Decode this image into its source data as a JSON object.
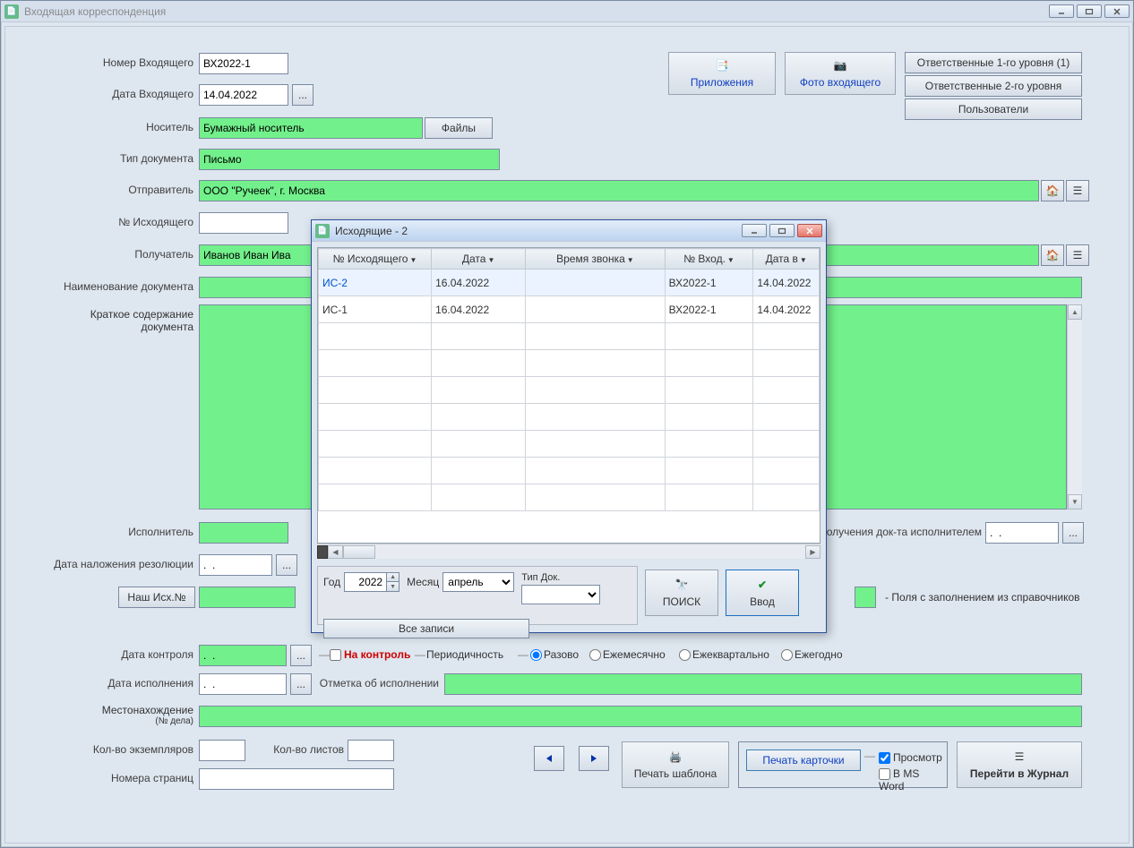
{
  "main": {
    "title": "Входящая корреспонденция",
    "labels": {
      "incoming_no": "Номер Входящего",
      "incoming_date": "Дата Входящего",
      "medium": "Носитель",
      "doc_type": "Тип документа",
      "sender": "Отправитель",
      "outgoing_no": "№ Исходящего",
      "recipient": "Получатель",
      "doc_name": "Наименование документа",
      "summary1": "Краткое содержание",
      "summary2": "документа",
      "executor": "Исполнитель",
      "exec_date_label": "олучения док-та исполнителем",
      "resolution_date": "Дата наложения резолюции",
      "our_outgoing": "Наш Исх.№",
      "control_date": "Дата контроля",
      "exec_done_date": "Дата исполнения",
      "exec_mark": "Отметка об исполнении",
      "location1": "Местонахождение",
      "location2": "(№ дела)",
      "copies": "Кол-во экземпляров",
      "pages": "Кол-во листов",
      "page_numbers": "Номера страниц"
    },
    "values": {
      "incoming_no": "ВХ2022-1",
      "incoming_date": "14.04.2022",
      "medium": "Бумажный носитель",
      "doc_type": "Письмо",
      "sender": "ООО \"Ручеек\", г. Москва",
      "outgoing_no": "",
      "recipient": "Иванов Иван Ива",
      "doc_name": "",
      "summary": "",
      "executor": "",
      "exec_date": ".  .",
      "resolution_date": ".  .",
      "our_outgoing": "",
      "control_date": ".  .",
      "exec_done_date": ".  .",
      "exec_mark": "",
      "location": "",
      "copies": "",
      "pages": "",
      "page_numbers": ""
    },
    "buttons": {
      "files": "Файлы",
      "attachments": "Приложения",
      "photo": "Фото входящего",
      "responsible1": "Ответственные 1-го уровня (1)",
      "responsible2": "Ответственные 2-го уровня",
      "users": "Пользователи",
      "print_template": "Печать шаблона",
      "print_card": "Печать карточки",
      "preview": "Просмотр",
      "in_msword": "В MS Word",
      "goto_journal": "Перейти в Журнал"
    },
    "control": {
      "on_control": "На контроль",
      "periodicity": "Периодичность",
      "once": "Разово",
      "monthly": "Ежемесячно",
      "quarterly": "Ежеквартально",
      "yearly": "Ежегодно"
    },
    "legend": "- Поля с заполнением из справочников",
    "dotdotdot": "..."
  },
  "modal": {
    "title": "Исходящие - 2",
    "columns": {
      "outgoing_no": "№ Исходящего",
      "date": "Дата",
      "call_time": "Время звонка",
      "incoming_no": "№ Вход.",
      "date_v": "Дата в"
    },
    "rows": [
      {
        "out": "ИС-2",
        "date": "16.04.2022",
        "call": "",
        "in": "ВХ2022-1",
        "din": "14.04.2022"
      },
      {
        "out": "ИС-1",
        "date": "16.04.2022",
        "call": "",
        "in": "ВХ2022-1",
        "din": "14.04.2022"
      }
    ],
    "filters": {
      "year_label": "Год",
      "year_value": "2022",
      "month_label": "Месяц",
      "month_value": "апрель",
      "doctype_label": "Тип Док.",
      "doctype_value": "",
      "all_records": "Все записи",
      "search": "ПОИСК",
      "input": "Ввод"
    }
  }
}
